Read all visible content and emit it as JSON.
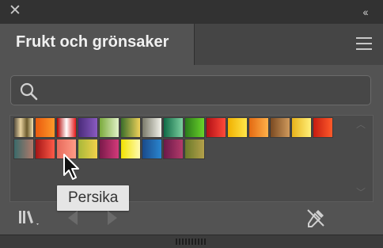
{
  "window": {
    "close_glyph": "✕",
    "collapse_glyph": "‹‹"
  },
  "tabs": [
    {
      "label": "Frukt och grönsaker",
      "active": true
    }
  ],
  "search": {
    "value": "",
    "placeholder": ""
  },
  "swatches": {
    "rows": [
      [
        {
          "gradient": [
            "#5b5140",
            "#e8d3a0",
            "#6b5a2c",
            "#f2e3b2"
          ]
        },
        {
          "gradient": [
            "#e95a0e",
            "#ff9a2a"
          ]
        },
        {
          "gradient": [
            "#b40000",
            "#ffffff",
            "#e2191a"
          ]
        },
        {
          "gradient": [
            "#4a2b7a",
            "#8a5bc1"
          ]
        },
        {
          "gradient": [
            "#7aaa3c",
            "#e2f2c9"
          ]
        },
        {
          "gradient": [
            "#3a6e2a",
            "#f0d25a"
          ]
        },
        {
          "gradient": [
            "#7a7a6a",
            "#f2f2ea"
          ]
        },
        {
          "gradient": [
            "#0f6a46",
            "#7dd0a0"
          ]
        },
        {
          "gradient": [
            "#2a7a1a",
            "#6ad42a"
          ]
        },
        {
          "gradient": [
            "#b31016",
            "#ff4a3a"
          ]
        },
        {
          "gradient": [
            "#f0b000",
            "#ffe64a"
          ]
        },
        {
          "gradient": [
            "#e36a12",
            "#ffb14a"
          ]
        },
        {
          "gradient": [
            "#7a4a22",
            "#d09a5c"
          ]
        },
        {
          "gradient": [
            "#e8b21a",
            "#fff07a"
          ]
        },
        {
          "gradient": [
            "#c41c10",
            "#ff5a2a"
          ]
        }
      ],
      [
        {
          "gradient": [
            "#3a6a6a",
            "#b07a6a"
          ]
        },
        {
          "gradient": [
            "#a31616",
            "#ff5a48"
          ]
        },
        {
          "gradient": [
            "#e86a5c",
            "#ff9c86"
          ],
          "name": "Persika"
        },
        {
          "gradient": [
            "#a8b83a",
            "#f2d24a"
          ]
        },
        {
          "gradient": [
            "#7a1a4a",
            "#d43a7a"
          ]
        },
        {
          "gradient": [
            "#f2e100",
            "#fffbb0"
          ]
        },
        {
          "gradient": [
            "#1a4a8a",
            "#2a86d0"
          ]
        },
        {
          "gradient": [
            "#6a1a4a",
            "#b43a6a"
          ]
        },
        {
          "gradient": [
            "#6a7a2a",
            "#b4a04a"
          ]
        }
      ]
    ]
  },
  "tooltip": {
    "text": "Persika"
  },
  "footer": {
    "library_icon": "swatch-libraries-menu-icon",
    "prev_icon": "triangle-left",
    "next_icon": "triangle-right",
    "eyedropper_icon": "eyedropper-slash"
  },
  "colors": {
    "panel_bg": "#535353",
    "titlebar_bg": "#323232",
    "tooltip_bg": "#e5e5e5"
  }
}
